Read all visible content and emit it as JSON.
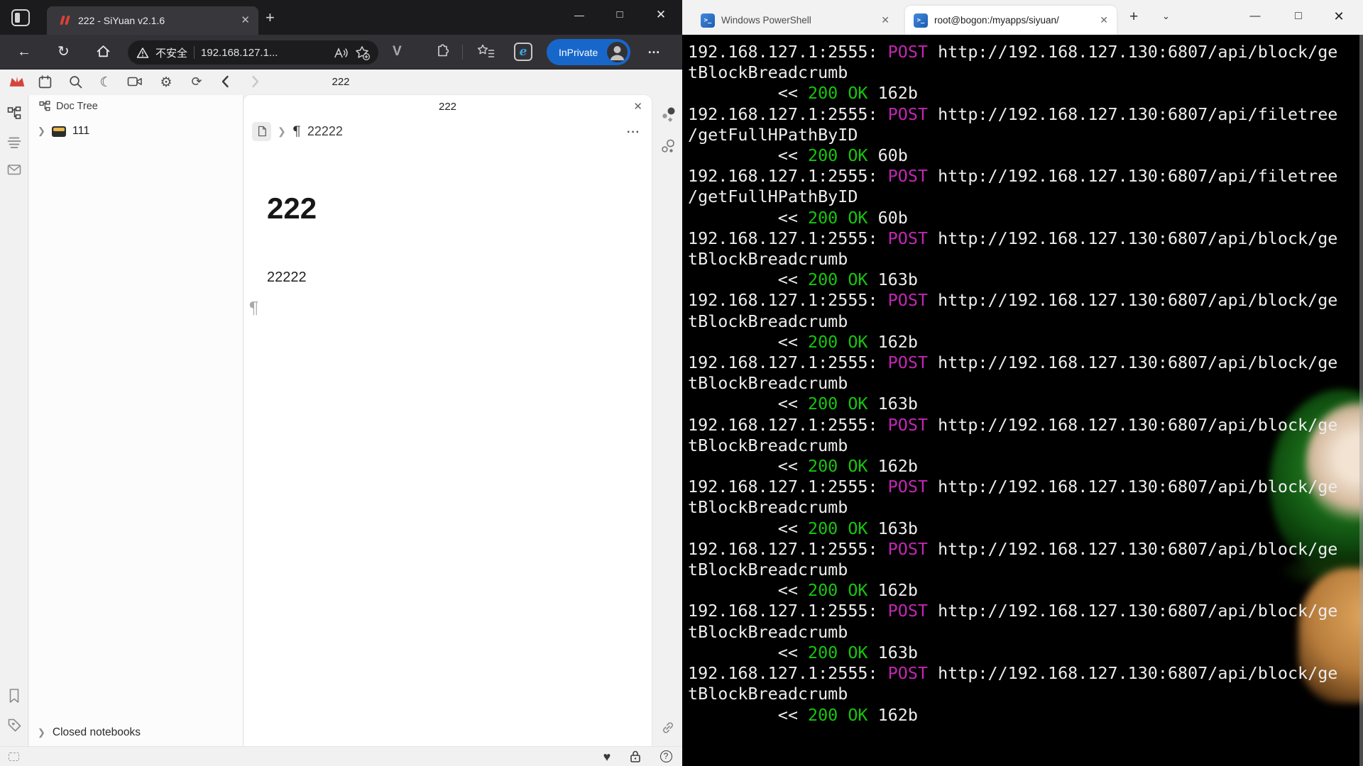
{
  "browser": {
    "tab_title": "222 - SiYuan v2.1.6",
    "security_label": "不安全",
    "url_display": "192.168.127.1...",
    "inprivate_label": "InPrivate"
  },
  "siyuan": {
    "window_title": "222",
    "doc_tree": {
      "header": "Doc Tree",
      "notebook": "111",
      "closed_notebooks": "Closed notebooks"
    },
    "editor": {
      "tab_title": "222",
      "breadcrumb_pilcrow": "¶",
      "breadcrumb_doc": "22222",
      "more_label": "···",
      "heading": "222",
      "paragraph": "22222",
      "empty_block_marker": "¶"
    }
  },
  "terminal": {
    "tabs": [
      {
        "label": "Windows PowerShell"
      },
      {
        "label": "root@bogon:/myapps/siyuan/"
      }
    ],
    "log": {
      "source": "192.168.127.1:2555:",
      "method": "POST",
      "response_arrow": "<<",
      "status": "200 OK",
      "requests": [
        {
          "url_line1": "http://192.168.127.130:6807/api/block/ge",
          "url_line2": "tBlockBreadcrumb",
          "size": "162b"
        },
        {
          "url_line1": "http://192.168.127.130:6807/api/filetree",
          "url_line2": "/getFullHPathByID",
          "size": "60b"
        },
        {
          "url_line1": "http://192.168.127.130:6807/api/filetree",
          "url_line2": "/getFullHPathByID",
          "size": "60b"
        },
        {
          "url_line1": "http://192.168.127.130:6807/api/block/ge",
          "url_line2": "tBlockBreadcrumb",
          "size": "163b"
        },
        {
          "url_line1": "http://192.168.127.130:6807/api/block/ge",
          "url_line2": "tBlockBreadcrumb",
          "size": "162b"
        },
        {
          "url_line1": "http://192.168.127.130:6807/api/block/ge",
          "url_line2": "tBlockBreadcrumb",
          "size": "163b"
        },
        {
          "url_line1": "http://192.168.127.130:6807/api/block/ge",
          "url_line2": "tBlockBreadcrumb",
          "size": "162b"
        },
        {
          "url_line1": "http://192.168.127.130:6807/api/block/ge",
          "url_line2": "tBlockBreadcrumb",
          "size": "163b"
        },
        {
          "url_line1": "http://192.168.127.130:6807/api/block/ge",
          "url_line2": "tBlockBreadcrumb",
          "size": "162b"
        },
        {
          "url_line1": "http://192.168.127.130:6807/api/block/ge",
          "url_line2": "tBlockBreadcrumb",
          "size": "163b"
        },
        {
          "url_line1": "http://192.168.127.130:6807/api/block/ge",
          "url_line2": "tBlockBreadcrumb",
          "size": "162b"
        }
      ]
    }
  },
  "colors": {
    "method_magenta": "#c226b4",
    "status_green": "#16c60c",
    "terminal_text": "#ededed",
    "inprivate_blue": "#1767cb",
    "siyuan_red": "#d5443c"
  }
}
